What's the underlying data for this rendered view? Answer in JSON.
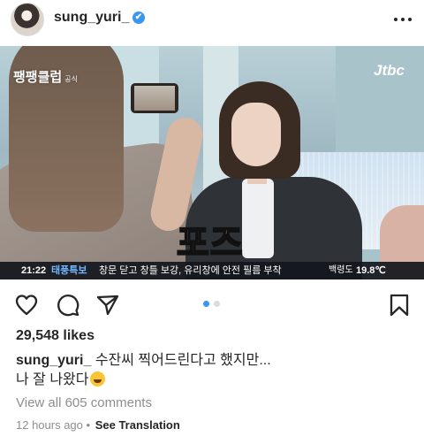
{
  "post": {
    "username": "sung_yuri_",
    "verified_mark": "✔",
    "media": {
      "show_logo": "팽팽클럽",
      "show_logo_sub": "공식",
      "channel_logo": "Jtbc",
      "big_caption": "포즈",
      "ticker": {
        "time": "21:22",
        "tag": "태풍특보",
        "text": "창문 닫고 창틀 보강, 유리창에 안전 필름 부착",
        "location": "백령도",
        "temperature": "19.8℃"
      },
      "carousel": {
        "count": 2,
        "active_index": 0
      }
    },
    "likes_text": "29,548 likes",
    "caption_user": "sung_yuri_",
    "caption_line1": "수잔씨 찍어드린다고 했지만...",
    "caption_line2": "나 잘 나왔다",
    "view_comments": "View all 605 comments",
    "timestamp": "12 hours ago",
    "separator": "•",
    "see_translation": "See Translation"
  },
  "icons": {
    "more": "more-options-icon",
    "like": "heart-icon",
    "comment": "comment-icon",
    "share": "share-icon",
    "save": "bookmark-icon"
  },
  "colors": {
    "verified": "#3897f0",
    "carousel_active": "#3897f0",
    "carousel_inactive": "#dbdbdb",
    "text": "#262626",
    "muted": "#8e8e8e"
  }
}
